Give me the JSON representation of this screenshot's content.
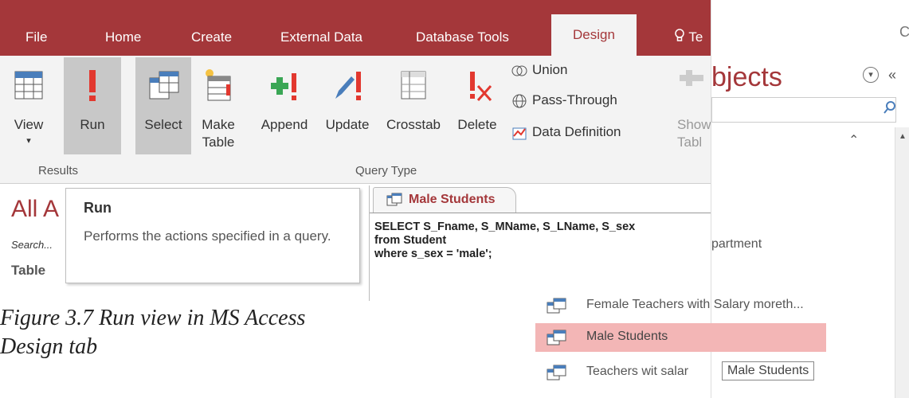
{
  "ribbon": {
    "tabs": [
      "File",
      "Home",
      "Create",
      "External Data",
      "Database Tools",
      "Design",
      "Te"
    ],
    "tell_me_icon": "lightbulb-icon",
    "buttons": {
      "view": "View",
      "run": "Run",
      "select": "Select",
      "make_table_1": "Make",
      "make_table_2": "Table",
      "append": "Append",
      "update": "Update",
      "crosstab": "Crosstab",
      "delete": "Delete",
      "show_table_1": "Show",
      "show_table_2": "Tabl"
    },
    "small_items": {
      "union": "Union",
      "pass_through": "Pass-Through",
      "data_definition": "Data Definition"
    },
    "groups": {
      "results": "Results",
      "query_type": "Query Type"
    }
  },
  "nav_pane": {
    "title_partial": "All A",
    "search_placeholder": "Search...",
    "section": "Table",
    "objects_title": "bjects",
    "item_partial": "partment",
    "items": [
      "Female Teachers with Salary moreth...",
      "Male Students",
      "Teachers wit salar"
    ],
    "hover_tooltip": "Male Students",
    "right_edge": "C"
  },
  "tooltip": {
    "title": "Run",
    "description": "Performs the actions specified in a query."
  },
  "document": {
    "tab": "Male Students",
    "sql": "SELECT S_Fname, S_MName, S_LName, S_sex\nfrom Student\nwhere s_sex = 'male';"
  },
  "caption": {
    "line1": "Figure 3.7 Run view in MS Access",
    "line2": "Design tab"
  },
  "colors": {
    "accent": "#a4373a",
    "ribbon_bg": "#f3f3f3",
    "selected_row": "#f3b6b6",
    "pressed": "#c8c8c8"
  }
}
